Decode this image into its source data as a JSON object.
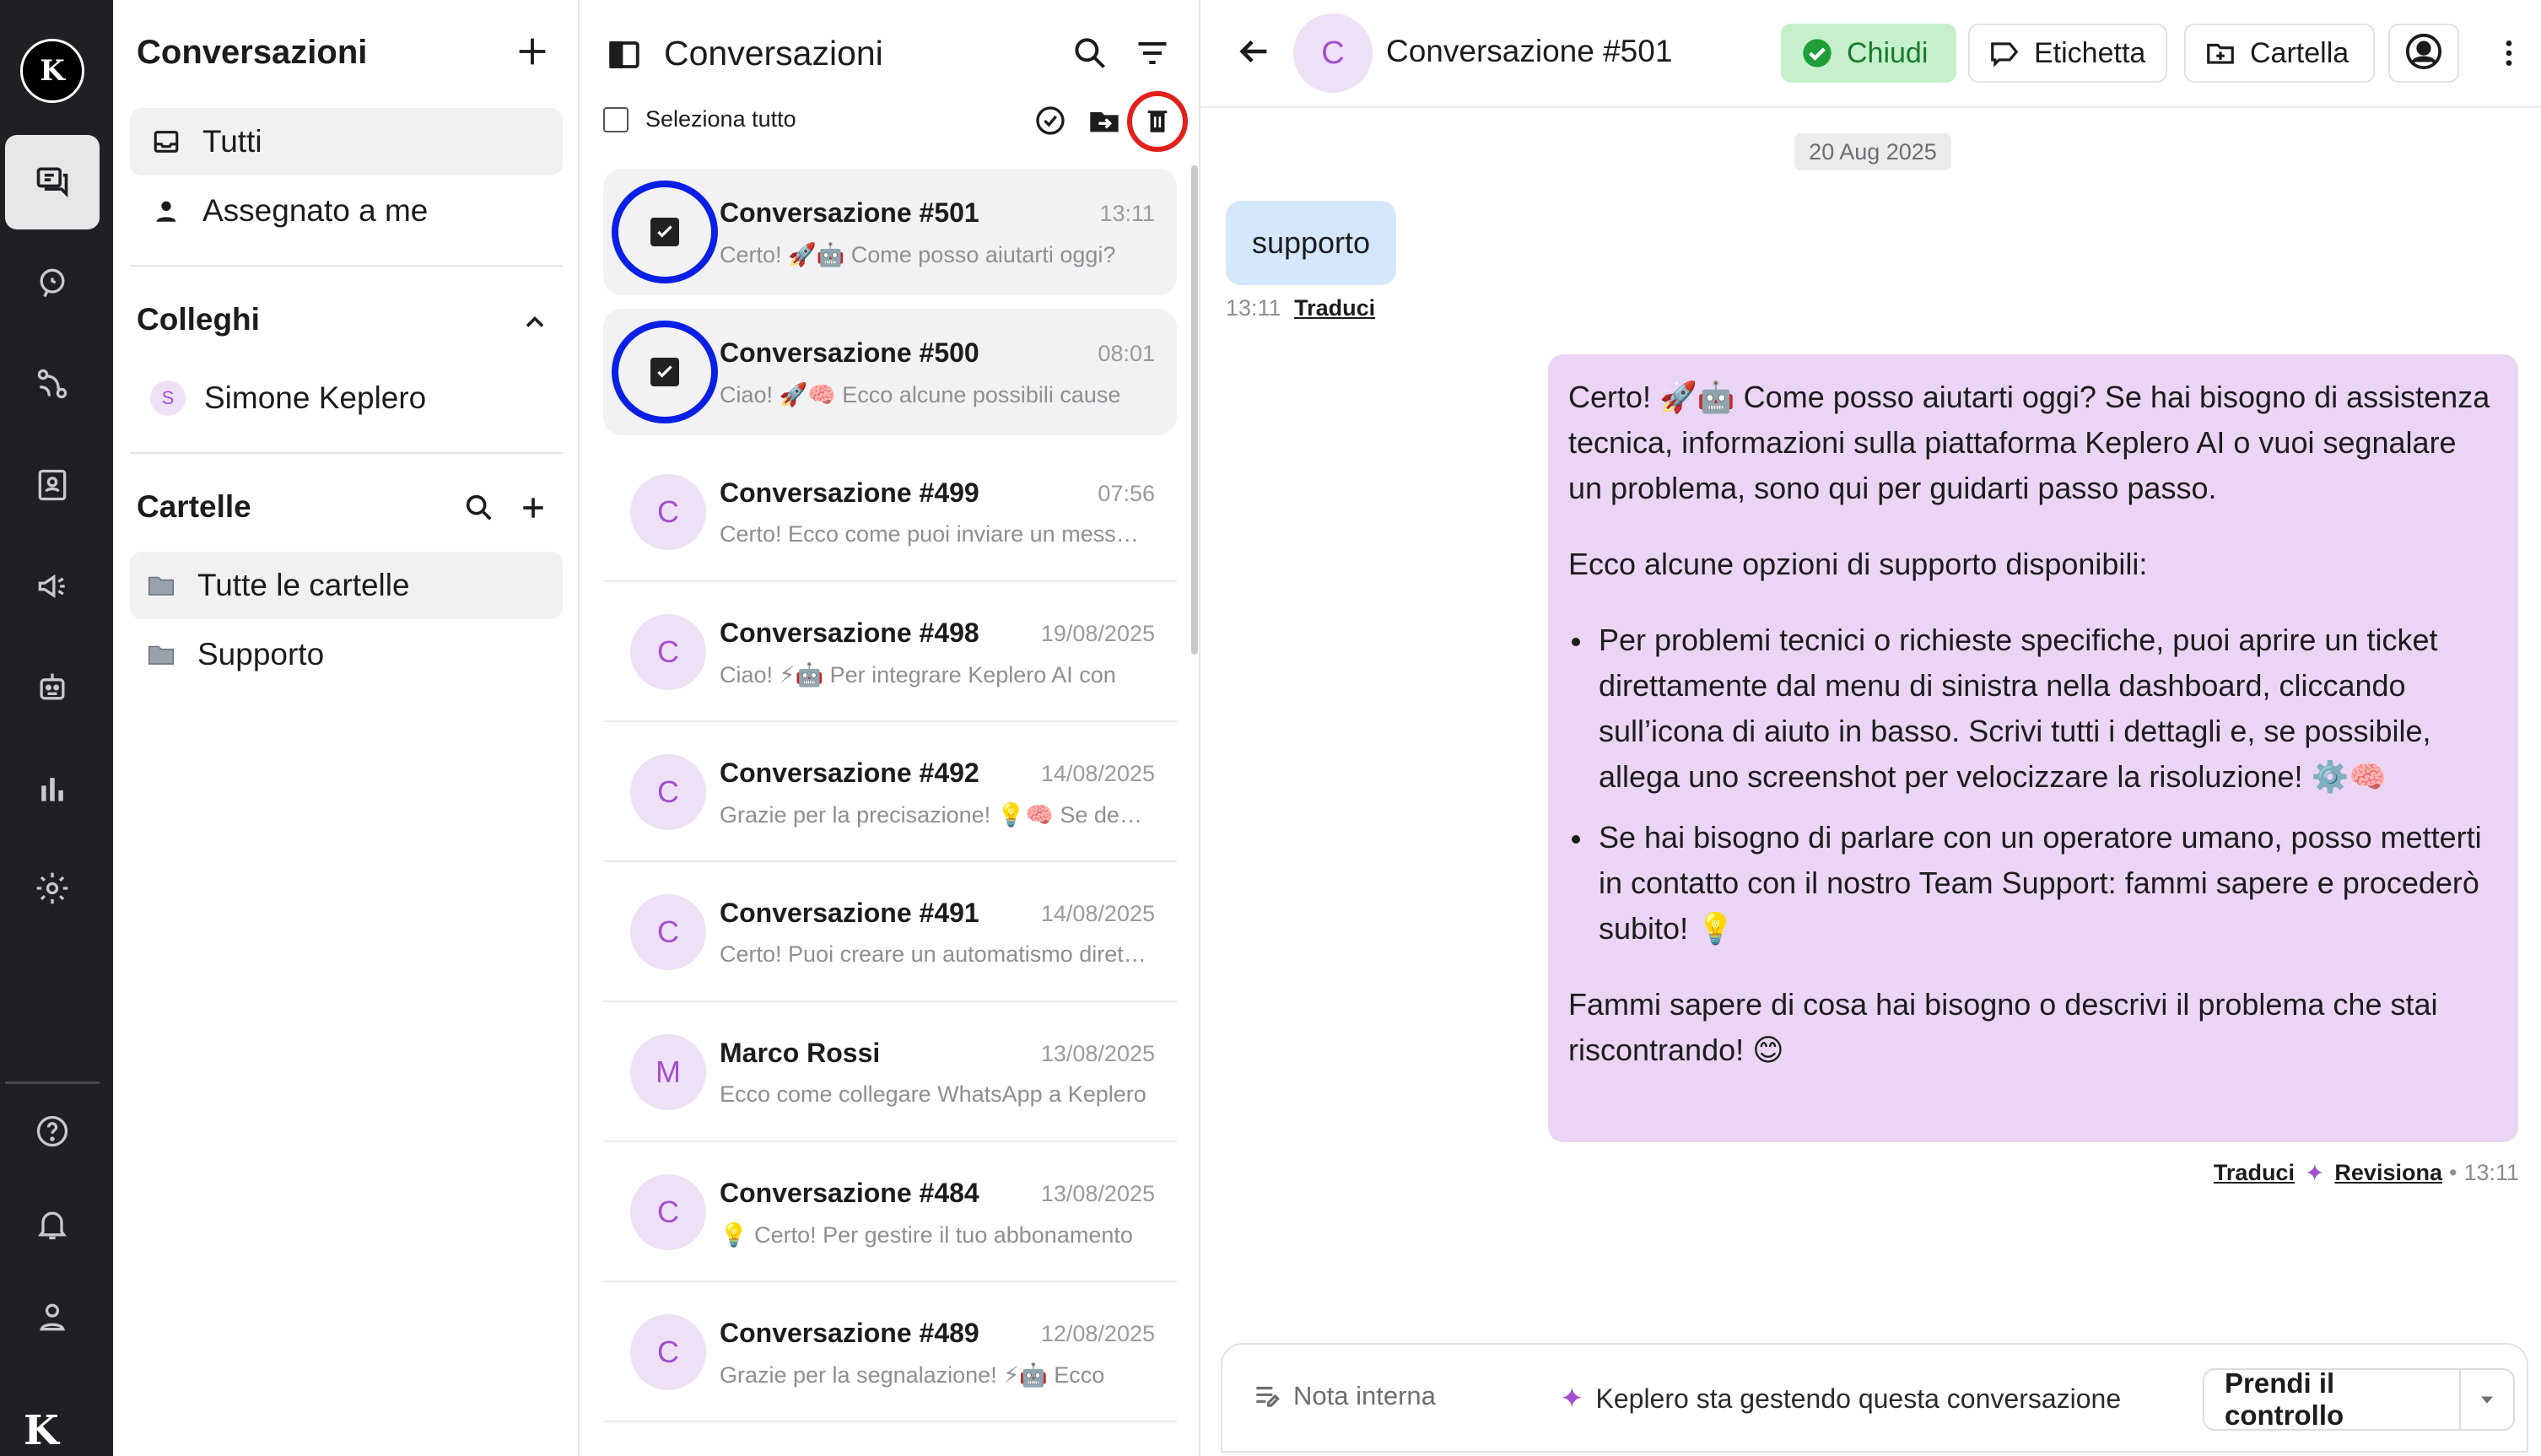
{
  "app": {
    "logo_text": "K",
    "bottom_logo": "K"
  },
  "rail": {
    "items": [
      {
        "icon": "chat-icon",
        "active": true
      },
      {
        "icon": "support-icon"
      },
      {
        "icon": "flow-icon"
      },
      {
        "icon": "contacts-icon"
      },
      {
        "icon": "megaphone-icon"
      },
      {
        "icon": "bot-icon"
      },
      {
        "icon": "analytics-icon"
      },
      {
        "icon": "settings-icon"
      },
      {
        "icon": "help-icon"
      },
      {
        "icon": "bell-icon"
      },
      {
        "icon": "profile-icon"
      }
    ]
  },
  "sidebar": {
    "title": "Conversazioni",
    "nav": [
      {
        "label": "Tutti",
        "icon": "inbox-icon",
        "active": true
      },
      {
        "label": "Assegnato a me",
        "icon": "person-icon"
      }
    ],
    "colleagues_title": "Colleghi",
    "colleagues": [
      {
        "label": "Simone Keplero",
        "initial": "S"
      }
    ],
    "folders_title": "Cartelle",
    "folders": [
      {
        "label": "Tutte le cartelle",
        "active": true
      },
      {
        "label": "Supporto"
      }
    ]
  },
  "list": {
    "title": "Conversazioni",
    "select_all": "Seleziona tutto",
    "conversations": [
      {
        "name": "Conversazione #501",
        "time": "13:11",
        "preview": "Certo! 🚀🤖 Come posso aiutarti oggi?",
        "initial": "C",
        "selected": true
      },
      {
        "name": "Conversazione #500",
        "time": "08:01",
        "preview": "Ciao! 🚀🧠 Ecco alcune possibili cause",
        "initial": "C",
        "selected": true
      },
      {
        "name": "Conversazione #499",
        "time": "07:56",
        "preview": "Certo! Ecco come puoi inviare un messaggio",
        "initial": "C"
      },
      {
        "name": "Conversazione #498",
        "time": "19/08/2025",
        "preview": "Ciao! ⚡🤖 Per integrare Keplero AI con",
        "initial": "C"
      },
      {
        "name": "Conversazione #492",
        "time": "14/08/2025",
        "preview": "Grazie per la precisazione! 💡🧠 Se desideri",
        "initial": "C"
      },
      {
        "name": "Conversazione #491",
        "time": "14/08/2025",
        "preview": "Certo! Puoi creare un automatismo direttamente",
        "initial": "C"
      },
      {
        "name": "Marco Rossi",
        "time": "13/08/2025",
        "preview": "Ecco come collegare WhatsApp a Keplero",
        "initial": "M"
      },
      {
        "name": "Conversazione #484",
        "time": "13/08/2025",
        "preview": "💡 Certo! Per gestire il tuo abbonamento",
        "initial": "C"
      },
      {
        "name": "Conversazione #489",
        "time": "12/08/2025",
        "preview": "Grazie per la segnalazione! ⚡🤖 Ecco",
        "initial": "C"
      }
    ]
  },
  "chat": {
    "title": "Conversazione #501",
    "initial": "C",
    "buttons": {
      "close": "Chiudi",
      "label": "Etichetta",
      "folder": "Cartella"
    },
    "date": "20 Aug 2025",
    "incoming": {
      "text": "supporto",
      "time": "13:11",
      "translate": "Traduci"
    },
    "outgoing": {
      "p1": "Certo! 🚀🤖 Come posso aiutarti oggi? Se hai bisogno di assistenza tecnica, informazioni sulla piattaforma Keplero AI o vuoi segnalare un problema, sono qui per guidarti passo passo.",
      "p2": "Ecco alcune opzioni di supporto disponibili:",
      "b1": "Per problemi tecnici o richieste specifiche, puoi aprire un ticket direttamente dal menu di sinistra nella dashboard, cliccando sull’icona di aiuto in basso. Scrivi tutti i dettagli e, se possibile, allega uno screenshot per velocizzare la risoluzione! ⚙️🧠",
      "b2": "Se hai bisogno di parlare con un operatore umano, posso metterti in contatto con il nostro Team Support: fammi sapere e procederò subito! 💡",
      "p3": "Fammi sapere di cosa hai bisogno o descrivi il problema che stai riscontrando! 😊",
      "translate": "Traduci",
      "revise": "Revisiona",
      "time": "13:11"
    },
    "composer": {
      "note": "Nota interna",
      "status": "Keplero sta gestendo questa conversazione",
      "take": "Prendi il controllo"
    }
  },
  "colors": {
    "accent": "#a24fd1",
    "selection_ring": "#0a1fe6",
    "delete_ring": "#e3201b",
    "close_green": "#c6f0cc"
  }
}
